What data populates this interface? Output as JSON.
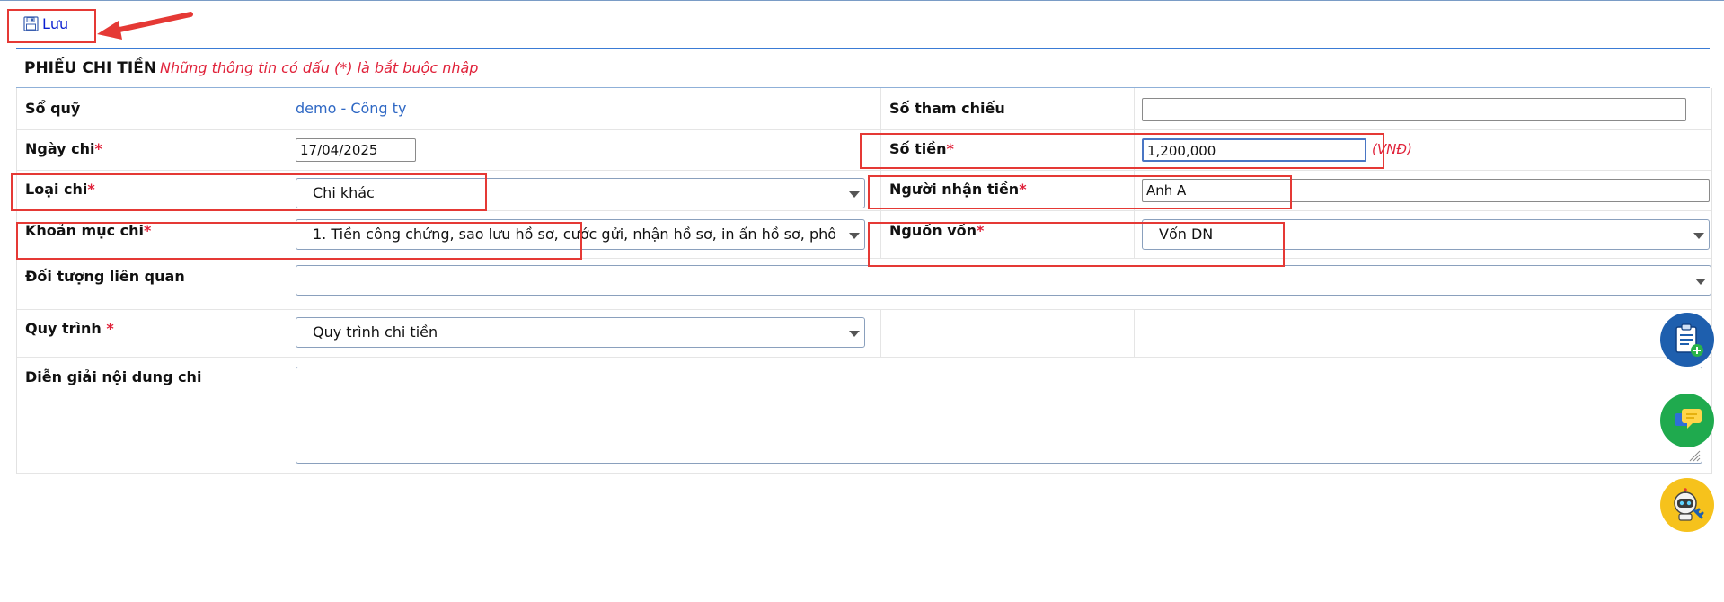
{
  "toolbar": {
    "save_label": "Lưu"
  },
  "form": {
    "title": "PHIẾU CHI TIỀN",
    "required_note": "Những thông tin có dấu (*) là bắt buộc nhập",
    "required_mark": "*",
    "fields": {
      "so_quy": {
        "label": "Sổ quỹ",
        "value": "demo - Công ty"
      },
      "so_tham_chieu": {
        "label": "Số tham chiếu",
        "value": ""
      },
      "ngay_chi": {
        "label": "Ngày chi",
        "value": "17/04/2025"
      },
      "so_tien": {
        "label": "Số tiền",
        "value": "1,200,000",
        "unit": "(VNĐ)"
      },
      "loai_chi": {
        "label": "Loại chi",
        "value": "Chi khác"
      },
      "nguoi_nhan_tien": {
        "label": "Người nhận tiền",
        "value": "Anh A"
      },
      "khoan_muc_chi": {
        "label": "Khoản mục chi",
        "value": "1. Tiền công chứng, sao lưu hồ sơ, cước gửi, nhận hồ sơ, in ấn hồ sơ, phô"
      },
      "nguon_von": {
        "label": "Nguồn vốn",
        "value": "Vốn DN"
      },
      "doi_tuong_lien_quan": {
        "label": "Đối tượng liên quan",
        "value": ""
      },
      "quy_trinh": {
        "label": "Quy trình ",
        "value": "Quy trình chi tiền"
      },
      "dien_giai": {
        "label": "Diễn giải nội dung chi",
        "value": ""
      }
    }
  },
  "floating_buttons": [
    {
      "icon": "clipboard-add-icon",
      "color": "#1e5fae"
    },
    {
      "icon": "chat-icon",
      "color": "#1faa4e"
    },
    {
      "icon": "robot-support-icon",
      "color": "#f6c21c"
    }
  ],
  "colors": {
    "accent": "#3a7bd5",
    "required": "#e0223a",
    "highlight": "#e53935",
    "link": "#2f68c4"
  }
}
